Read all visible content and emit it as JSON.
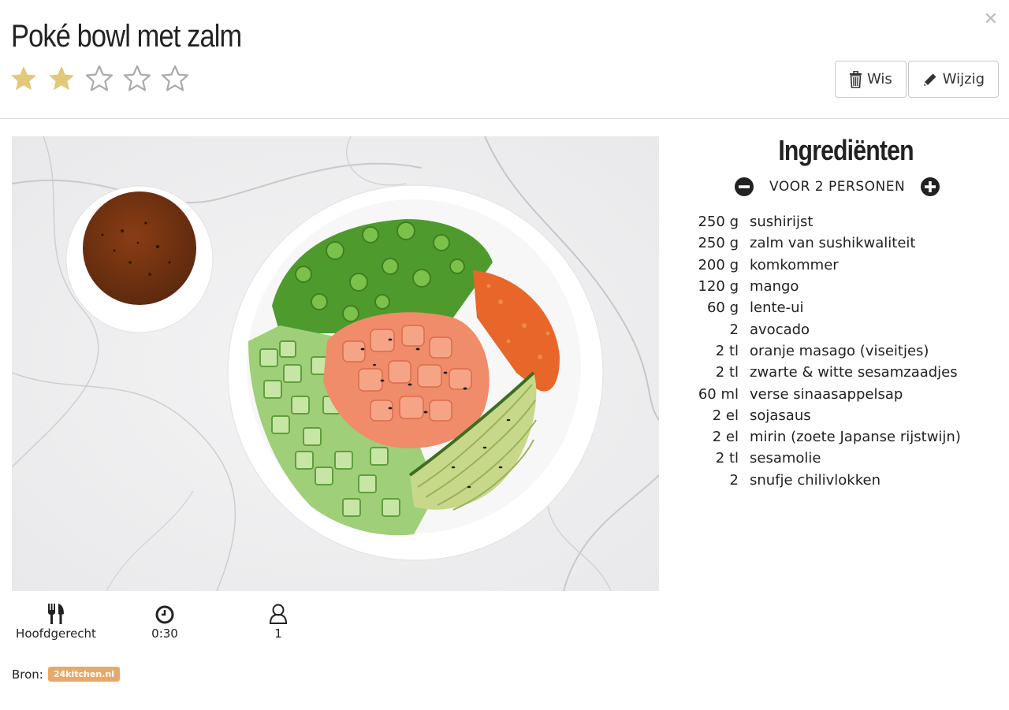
{
  "recipe": {
    "title": "Poké bowl met zalm",
    "rating": 2,
    "rating_max": 5,
    "star_colors": {
      "filled": "#e2c878",
      "empty": "#aaaaaa"
    }
  },
  "actions": {
    "delete_label": "Wis",
    "edit_label": "Wijzig",
    "close_icon": "close-icon"
  },
  "meta": {
    "category": "Hoofdgerecht",
    "time": "0:30",
    "persons": "1"
  },
  "source": {
    "label": "Bron:",
    "badge": "24kitchen.nl",
    "badge_color": "#e8a968"
  },
  "ingredients": {
    "title": "Ingrediënten",
    "servings_label": "VOOR 2 PERSONEN",
    "items": [
      {
        "qty": "250 g",
        "name": "sushirijst"
      },
      {
        "qty": "250 g",
        "name": "zalm van sushikwaliteit"
      },
      {
        "qty": "200 g",
        "name": "komkommer"
      },
      {
        "qty": "120 g",
        "name": "mango"
      },
      {
        "qty": "60 g",
        "name": "lente-ui"
      },
      {
        "qty": "2",
        "name": "avocado"
      },
      {
        "qty": "2 tl",
        "name": "oranje masago (viseitjes)"
      },
      {
        "qty": "2 tl",
        "name": "zwarte & witte sesamzaadjes"
      },
      {
        "qty": "60 ml",
        "name": "verse sinaasappelsap"
      },
      {
        "qty": "2 el",
        "name": "sojasaus"
      },
      {
        "qty": "2 el",
        "name": "mirin (zoete Japanse rijstwijn)"
      },
      {
        "qty": "2 tl",
        "name": "sesamolie"
      },
      {
        "qty": "2",
        "name": "snufje chilivlokken"
      }
    ]
  }
}
